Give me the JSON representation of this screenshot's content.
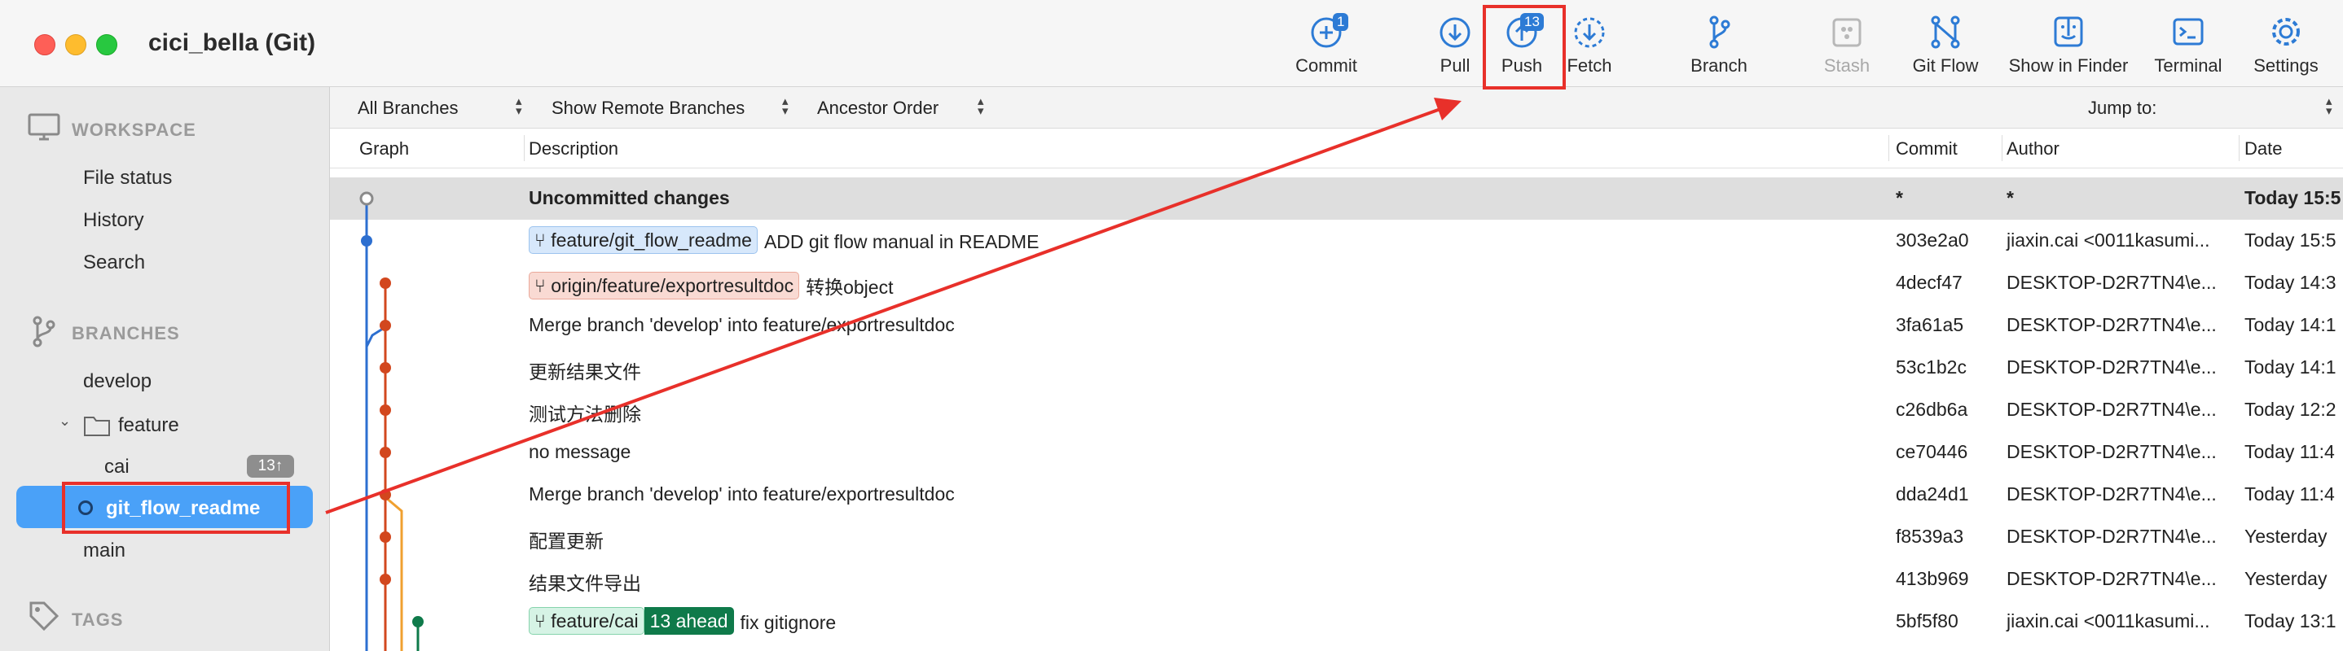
{
  "window": {
    "title": "cici_bella (Git)"
  },
  "toolbar": {
    "commit": {
      "label": "Commit",
      "badge": "1"
    },
    "pull": {
      "label": "Pull"
    },
    "push": {
      "label": "Push",
      "badge": "13"
    },
    "fetch": {
      "label": "Fetch"
    },
    "branch": {
      "label": "Branch"
    },
    "stash": {
      "label": "Stash"
    },
    "gitflow": {
      "label": "Git Flow"
    },
    "finder": {
      "label": "Show in Finder"
    },
    "terminal": {
      "label": "Terminal"
    },
    "settings": {
      "label": "Settings"
    }
  },
  "sidebar": {
    "workspace": {
      "title": "WORKSPACE",
      "items": [
        "File status",
        "History",
        "Search"
      ]
    },
    "branches": {
      "title": "BRANCHES",
      "develop": "develop",
      "folder": "feature",
      "cai": "cai",
      "cai_badge": "13↑",
      "selected": "git_flow_readme",
      "main": "main"
    },
    "tags": {
      "title": "TAGS"
    }
  },
  "filters": {
    "branches": "All Branches",
    "remote": "Show Remote Branches",
    "order": "Ancestor Order",
    "jump": "Jump to:"
  },
  "columns": {
    "graph": "Graph",
    "description": "Description",
    "commit": "Commit",
    "author": "Author",
    "date": "Date"
  },
  "rows": [
    {
      "tag": "",
      "desc": "Uncommitted changes",
      "commit": "*",
      "author": "*",
      "date": "Today 15:5"
    },
    {
      "tag": "feature/git_flow_readme",
      "desc": "ADD git flow manual in README",
      "commit": "303e2a0",
      "author": "jiaxin.cai <0011kasumi...",
      "date": "Today 15:5"
    },
    {
      "tag": "origin/feature/exportresultdoc",
      "desc": "转换object",
      "commit": "4decf47",
      "author": "DESKTOP-D2R7TN4\\e...",
      "date": "Today 14:3"
    },
    {
      "desc": "Merge branch 'develop' into feature/exportresultdoc",
      "commit": "3fa61a5",
      "author": "DESKTOP-D2R7TN4\\e...",
      "date": "Today 14:1"
    },
    {
      "desc": "更新结果文件",
      "commit": "53c1b2c",
      "author": "DESKTOP-D2R7TN4\\e...",
      "date": "Today 14:1"
    },
    {
      "desc": "测试方法删除",
      "commit": "c26db6a",
      "author": "DESKTOP-D2R7TN4\\e...",
      "date": "Today 12:2"
    },
    {
      "desc": "no message",
      "commit": "ce70446",
      "author": "DESKTOP-D2R7TN4\\e...",
      "date": "Today 11:4"
    },
    {
      "desc": "Merge branch 'develop' into feature/exportresultdoc",
      "commit": "dda24d1",
      "author": "DESKTOP-D2R7TN4\\e...",
      "date": "Today 11:4"
    },
    {
      "desc": "配置更新",
      "commit": "f8539a3",
      "author": "DESKTOP-D2R7TN4\\e...",
      "date": "Yesterday"
    },
    {
      "desc": "结果文件导出",
      "commit": "413b969",
      "author": "DESKTOP-D2R7TN4\\e...",
      "date": "Yesterday"
    },
    {
      "tag": "feature/cai",
      "ahead": "13 ahead",
      "desc": "fix gitignore",
      "commit": "5bf5f80",
      "author": "jiaxin.cai <0011kasumi...",
      "date": "Today 13:1"
    }
  ]
}
